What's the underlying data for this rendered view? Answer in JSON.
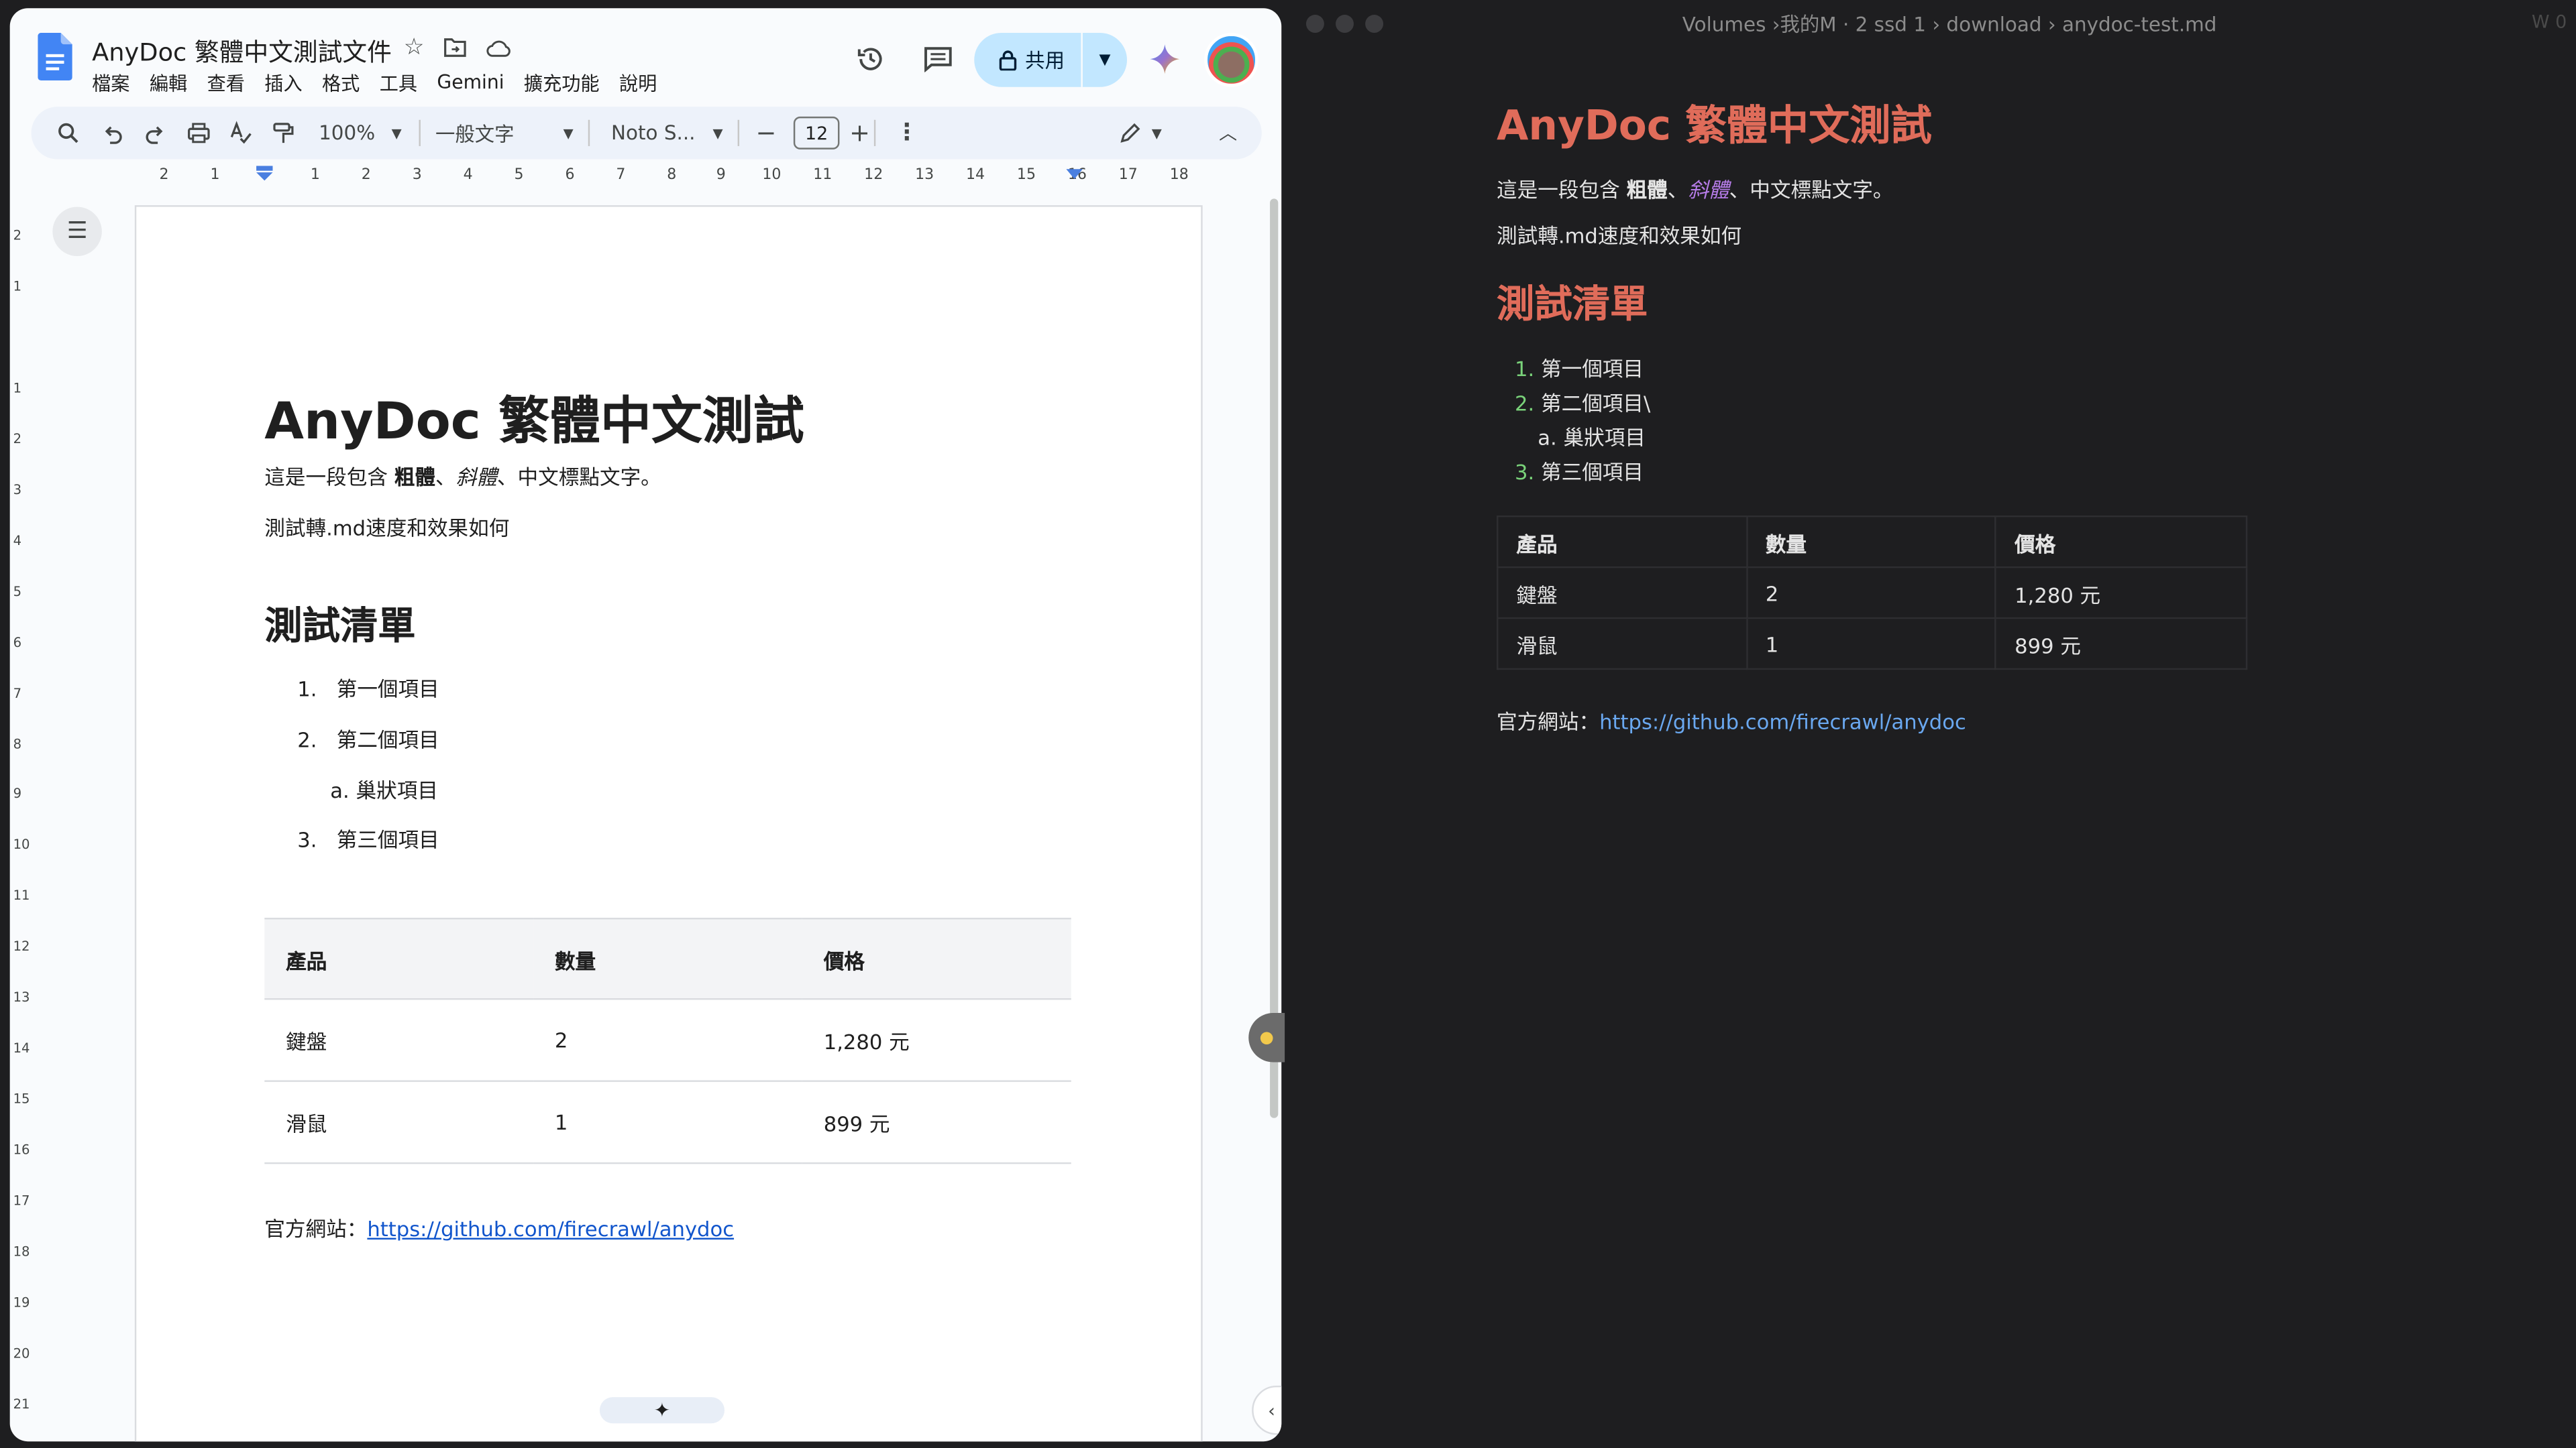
{
  "docs": {
    "title": "AnyDoc 繁體中文測試文件",
    "menu": [
      "檔案",
      "編輯",
      "查看",
      "插入",
      "格式",
      "工具",
      "Gemini",
      "擴充功能",
      "說明"
    ],
    "share_label": "共用",
    "toolbar": {
      "zoom": "100%",
      "style": "一般文字",
      "font": "Noto S...",
      "font_size": "12"
    },
    "ruler_marks": [
      "2",
      "1",
      "1",
      "2",
      "3",
      "4",
      "5",
      "6",
      "7",
      "8",
      "9",
      "10",
      "11",
      "12",
      "13",
      "14",
      "15",
      "16",
      "17",
      "18"
    ],
    "vruler_marks": [
      "2",
      "1",
      "1",
      "2",
      "3",
      "4",
      "5",
      "6",
      "7",
      "8",
      "9",
      "10",
      "11",
      "12",
      "13",
      "14",
      "15",
      "16",
      "17",
      "18",
      "19",
      "20",
      "21"
    ],
    "heading": "AnyDoc 繁體中文測試",
    "para1": {
      "prefix": "這是一段包含 ",
      "bold": "粗體",
      "sep": "、",
      "italic": "斜體",
      "suffix": "、中文標點文字。"
    },
    "para2": "測試轉.md速度和效果如何",
    "heading2": "測試清單",
    "list": [
      {
        "num": "1.",
        "text": "第一個項目"
      },
      {
        "num": "2.",
        "text": "第二個項目"
      },
      {
        "num": "a.",
        "text": "巢狀項目"
      },
      {
        "num": "3.",
        "text": "第三個項目"
      }
    ],
    "table": {
      "headers": [
        "產品",
        "數量",
        "價格"
      ],
      "rows": [
        [
          "鍵盤",
          "2",
          "1,280 元"
        ],
        [
          "滑鼠",
          "1",
          "899 元"
        ]
      ]
    },
    "site_label": "官方網站：",
    "site_url": "https://github.com/firecrawl/anydoc"
  },
  "md": {
    "path": "Volumes  ›我的M · 2 ssd 1  › download  › anydoc-test.md",
    "w_label": "W 0",
    "heading": "AnyDoc 繁體中文測試",
    "para1": {
      "prefix": "這是一段包含 ",
      "bold": "粗體",
      "sep": "、",
      "italic": "斜體",
      "suffix": "、中文標點文字。"
    },
    "para2": "測試轉.md速度和效果如何",
    "heading2": "測試清單",
    "list": [
      {
        "num": "1.",
        "text": "第一個項目"
      },
      {
        "num": "2.",
        "text": "第二個項目\\"
      },
      {
        "num": "a.",
        "text": "巢狀項目"
      },
      {
        "num": "3.",
        "text": "第三個項目"
      }
    ],
    "table": {
      "headers": [
        "產品",
        "數量",
        "價格"
      ],
      "rows": [
        [
          "鍵盤",
          "2",
          "1,280 元"
        ],
        [
          "滑鼠",
          "1",
          "899 元"
        ]
      ]
    },
    "site_label": "官方網站：",
    "site_url": "https://github.com/firecrawl/anydoc"
  },
  "colors": {
    "docs_blue": "#4285f4",
    "share_bg": "#c2e7ff",
    "md_heading": "#e06c5a",
    "md_link": "#6aa8f0",
    "md_list_number": "#7ad37a",
    "md_italic": "#b67ce8"
  },
  "icons": [
    "docs-logo-icon",
    "star-icon",
    "move-folder-icon",
    "cloud-saved-icon",
    "history-icon",
    "comment-icon",
    "lock-icon",
    "dropdown-icon",
    "gemini-icon",
    "search-icon",
    "undo-icon",
    "redo-icon",
    "print-icon",
    "spellcheck-icon",
    "paint-format-icon",
    "minus-icon",
    "plus-icon",
    "more-vert-icon",
    "edit-pencil-icon",
    "collapse-icon",
    "outline-icon",
    "sparkle-icon",
    "chevron-left-icon"
  ]
}
